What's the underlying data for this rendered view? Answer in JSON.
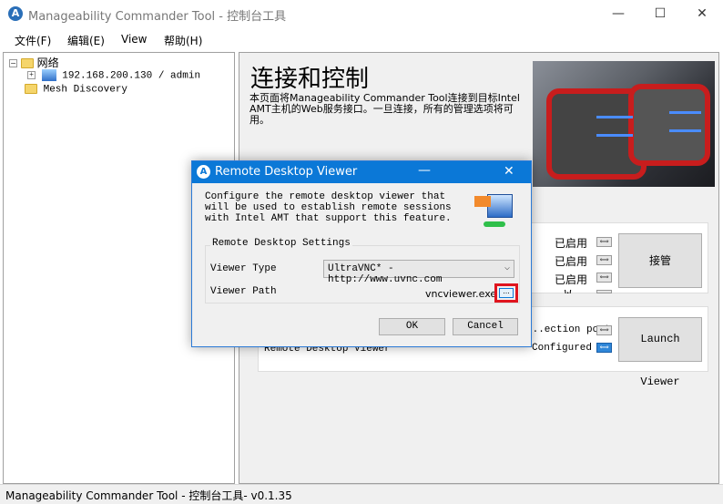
{
  "window": {
    "title": "Manageability Commander Tool - 控制台工具",
    "icon": "app-logo-icon",
    "controls": [
      "minimize-icon",
      "maximize-icon",
      "close-icon"
    ]
  },
  "menu": [
    "文件(F)",
    "编辑(E)",
    "View",
    "帮助(H)"
  ],
  "tree": {
    "root": "网络",
    "host": "192.168.200.130 / admin",
    "mesh": "Mesh Discovery"
  },
  "page": {
    "title": "连接和控制",
    "description": "本页面将Manageability Commander Tool连接到目标Intel AMT主机的Web服务接口。一旦连接，所有的管理选项将可用。"
  },
  "features": {
    "statuses": [
      "已启用",
      "已启用",
      "已启用",
      "W..."
    ],
    "takeover_label": "接管",
    "viewer_rows": [
      "...ection port",
      "Configured"
    ],
    "viewer_row_label": "Remote Desktop Viewer",
    "launch_label": "Launch Viewer"
  },
  "dialog": {
    "title": "Remote Desktop Viewer",
    "intro": "Configure the remote desktop viewer that will be used to establish remote sessions with Intel AMT that support this feature.",
    "group_label": "Remote Desktop Settings",
    "viewer_type_label": "Viewer Type",
    "viewer_type_value": "UltraVNC* - http://www.uvnc.com",
    "viewer_path_label": "Viewer Path",
    "viewer_path_value": "vncviewer.exe",
    "browse_label": "...",
    "ok_label": "OK",
    "cancel_label": "Cancel",
    "highlight_color": "#e0141e"
  },
  "status_bar": "Manageability Commander Tool - 控制台工具- v0.1.35"
}
